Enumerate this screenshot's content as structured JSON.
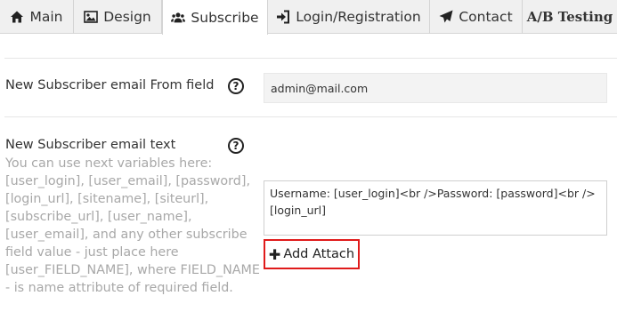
{
  "tabs": [
    {
      "label": "Main",
      "icon": "home-icon"
    },
    {
      "label": "Design",
      "icon": "image-icon"
    },
    {
      "label": "Subscribe",
      "icon": "users-icon"
    },
    {
      "label": "Login/Registration",
      "icon": "sign-in-icon"
    },
    {
      "label": "Contact",
      "icon": "paper-plane-icon"
    },
    {
      "label": "A/B Testing",
      "icon": ""
    }
  ],
  "active_tab": "Subscribe",
  "from_field": {
    "label": "New Subscriber email From field",
    "value": "admin@mail.com",
    "help_icon": "question-circle-icon"
  },
  "email_text": {
    "label": "New Subscriber email text",
    "hint": "You can use next variables here: [user_login], [user_email], [password], [login_url], [sitename], [siteurl], [subscribe_url], [user_name], [user_email], and any other subscribe field value - just place here [user_FIELD_NAME], where FIELD_NAME - is name attribute of required field.",
    "value": "Username: [user_login]<br />Password: [password]<br />[login_url]",
    "help_icon": "question-circle-icon",
    "add_attach_label": "Add Attach"
  },
  "colors": {
    "highlight_border": "#e01b1b",
    "hint_text": "#a8a8a8",
    "tab_bar": "#f0f0f0"
  }
}
